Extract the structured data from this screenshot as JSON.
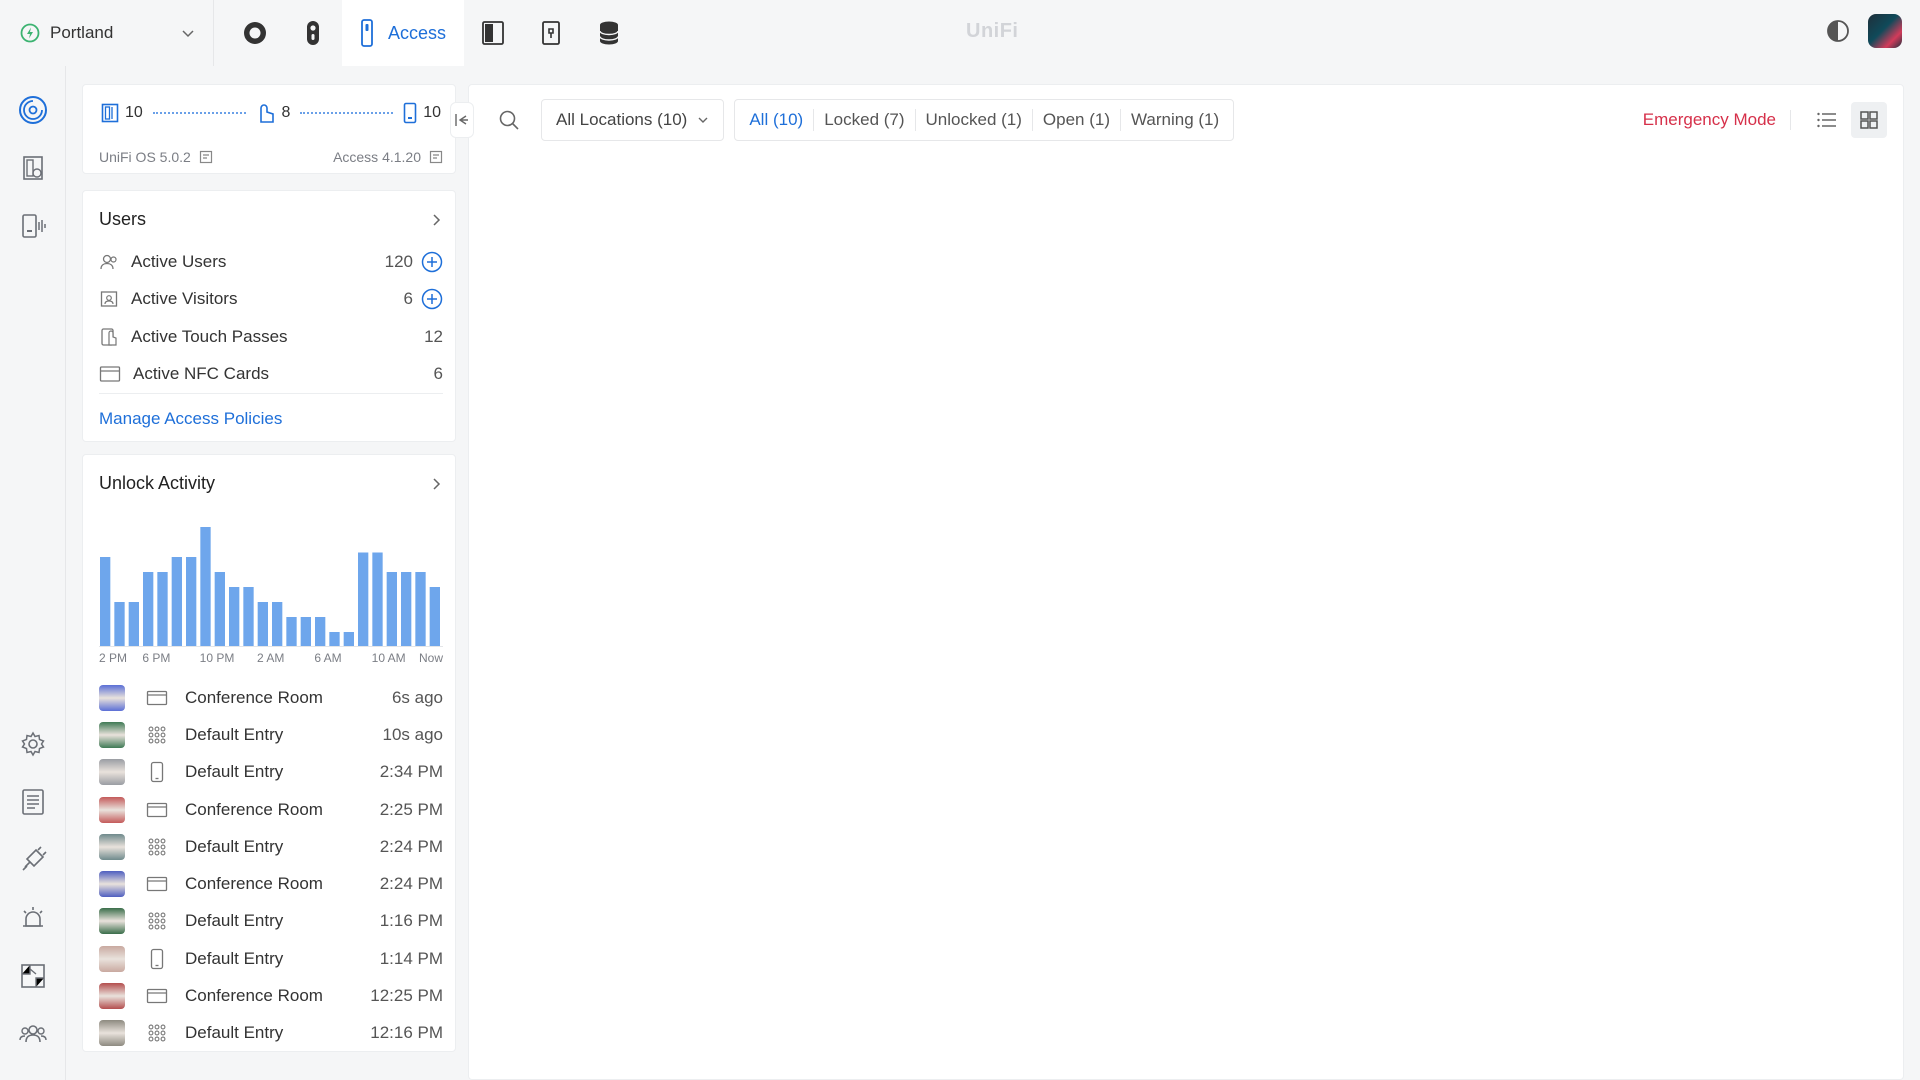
{
  "header": {
    "site": "Portland",
    "active_app": "Access",
    "brand": "UniFi"
  },
  "summary": {
    "doors": "10",
    "hubs": "8",
    "readers": "10",
    "os_version": "UniFi OS 5.0.2",
    "access_version": "Access 4.1.20"
  },
  "users": {
    "title": "Users",
    "items": [
      {
        "label": "Active Users",
        "count": "120"
      },
      {
        "label": "Active Visitors",
        "count": "6"
      },
      {
        "label": "Active Touch Passes",
        "count": "12"
      },
      {
        "label": "Active NFC Cards",
        "count": "6"
      }
    ],
    "manage_link": "Manage Access Policies"
  },
  "activity": {
    "title": "Unlock Activity",
    "items": [
      {
        "door": "Conference Room",
        "time": "6s ago",
        "method": "card-icon",
        "avatar": "#5b6fd6"
      },
      {
        "door": "Default Entry",
        "time": "10s ago",
        "method": "keypad-icon",
        "avatar": "#3f7a55"
      },
      {
        "door": "Default Entry",
        "time": "2:34 PM",
        "method": "phone-icon",
        "avatar": "#9a9da3"
      },
      {
        "door": "Conference Room",
        "time": "2:25 PM",
        "method": "card-icon",
        "avatar": "#c45a5a"
      },
      {
        "door": "Default Entry",
        "time": "2:24 PM",
        "method": "keypad-icon",
        "avatar": "#6f8a8c"
      },
      {
        "door": "Conference Room",
        "time": "2:24 PM",
        "method": "card-icon",
        "avatar": "#4f5fc0"
      },
      {
        "door": "Default Entry",
        "time": "1:16 PM",
        "method": "keypad-icon",
        "avatar": "#3a6e4a"
      },
      {
        "door": "Default Entry",
        "time": "1:14 PM",
        "method": "phone-icon",
        "avatar": "#c9a9a0"
      },
      {
        "door": "Conference Room",
        "time": "12:25 PM",
        "method": "card-icon",
        "avatar": "#b44e4e"
      },
      {
        "door": "Default Entry",
        "time": "12:16 PM",
        "method": "keypad-icon",
        "avatar": "#8d8a80"
      }
    ]
  },
  "chart_data": {
    "type": "bar",
    "values": [
      6,
      3,
      3,
      5,
      5,
      6,
      6,
      8,
      5,
      4,
      4,
      3,
      3,
      2,
      2,
      2,
      1,
      1,
      6.3,
      6.3,
      5,
      5,
      5,
      4
    ],
    "tick_labels": [
      "2 PM",
      "6 PM",
      "10 PM",
      "2 AM",
      "6 AM",
      "10 AM",
      "Now"
    ],
    "ylim": [
      0,
      8
    ],
    "color": "#6ea6ec"
  },
  "toolbar": {
    "location": "All Locations (10)",
    "filters": [
      "All (10)",
      "Locked (7)",
      "Unlocked (1)",
      "Open (1)",
      "Warning (1)"
    ],
    "emergency": "Emergency Mode"
  },
  "colors": {
    "accent": "#1e6fd9",
    "danger": "#d6304a",
    "online": "#3cb371"
  }
}
